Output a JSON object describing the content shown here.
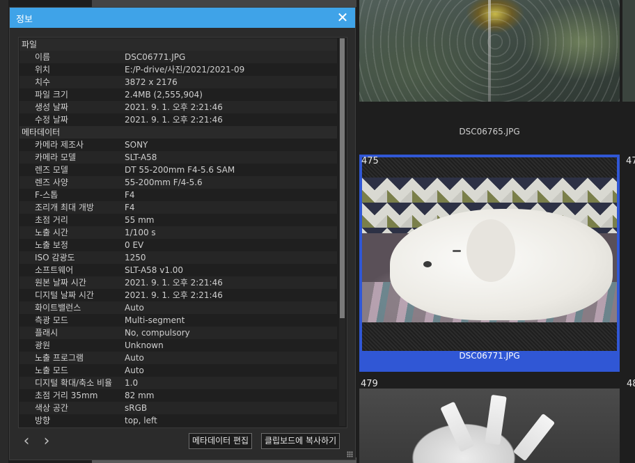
{
  "dialog": {
    "title": "정보",
    "sections": [
      {
        "label": "파일",
        "rows": [
          {
            "key": "이름",
            "value": "DSC06771.JPG"
          },
          {
            "key": "위치",
            "value": "E:/P-drive/사진/2021/2021-09"
          },
          {
            "key": "치수",
            "value": "3872 x 2176"
          },
          {
            "key": "파일 크기",
            "value": "2.4MB (2,555,904)"
          },
          {
            "key": "생성 날짜",
            "value": "2021. 9. 1. 오후 2:21:46"
          },
          {
            "key": "수정 날짜",
            "value": "2021. 9. 1. 오후 2:21:46"
          }
        ]
      },
      {
        "label": "메타데이터",
        "rows": [
          {
            "key": "카메라 제조사",
            "value": "SONY"
          },
          {
            "key": "카메라 모델",
            "value": "SLT-A58"
          },
          {
            "key": "렌즈 모델",
            "value": "DT 55-200mm F4-5.6 SAM"
          },
          {
            "key": "렌즈 사양",
            "value": "55-200mm F/4-5.6"
          },
          {
            "key": "F-스톱",
            "value": "F4"
          },
          {
            "key": "조리개 최대 개방",
            "value": "F4"
          },
          {
            "key": "초점 거리",
            "value": "55 mm"
          },
          {
            "key": "노출 시간",
            "value": "1/100 s"
          },
          {
            "key": "노출 보정",
            "value": "0 EV"
          },
          {
            "key": "ISO 감광도",
            "value": "1250"
          },
          {
            "key": "소프트웨어",
            "value": "SLT-A58 v1.00"
          },
          {
            "key": "원본 날짜 시간",
            "value": "2021. 9. 1. 오후 2:21:46"
          },
          {
            "key": "디지털 날짜 시간",
            "value": "2021. 9. 1. 오후 2:21:46"
          },
          {
            "key": "화이트밸런스",
            "value": "Auto"
          },
          {
            "key": "측광 모드",
            "value": "Multi-segment"
          },
          {
            "key": "플래시",
            "value": "No, compulsory"
          },
          {
            "key": "광원",
            "value": "Unknown"
          },
          {
            "key": "노출 프로그램",
            "value": "Auto"
          },
          {
            "key": "노출 모드",
            "value": "Auto"
          },
          {
            "key": "디지털 확대/축소 비율",
            "value": "1.0"
          },
          {
            "key": "초점 거리 35mm",
            "value": "82 mm"
          },
          {
            "key": "색상 공간",
            "value": "sRGB"
          },
          {
            "key": "방향",
            "value": "top, left"
          }
        ]
      }
    ],
    "buttons": {
      "edit_metadata": "메타데이터 편집",
      "copy_clipboard": "클립보드에 복사하기"
    },
    "nav": {
      "prev": "‹",
      "next": "›"
    },
    "close": "✕"
  },
  "gallery": {
    "caption_top": "DSC06765.JPG",
    "selected_index": "475",
    "selected_caption": "DSC06771.JPG",
    "next_index": "47",
    "bottom_index": "479",
    "bottom_next_index": "48"
  },
  "colors": {
    "title_bar": "#3fa3e8",
    "selection": "#3057d5"
  }
}
